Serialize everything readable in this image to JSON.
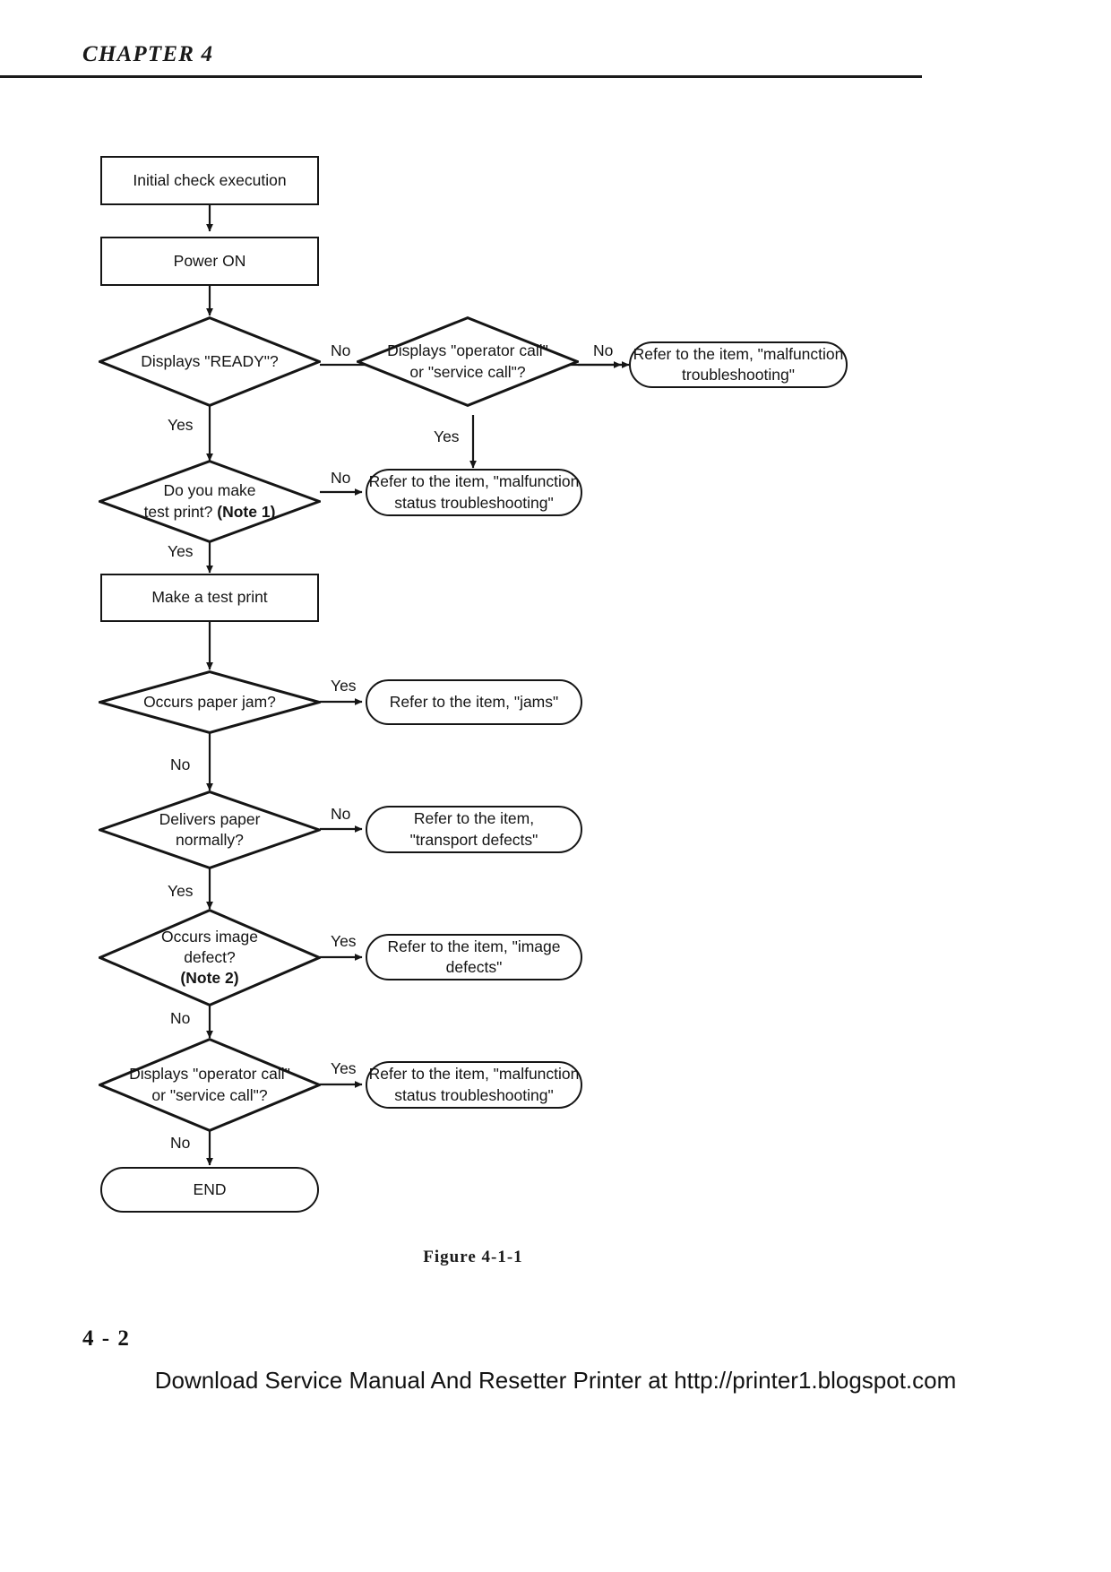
{
  "page": {
    "chapter": "CHAPTER 4",
    "figure_caption": "Figure 4-1-1",
    "page_number": "4 - 2",
    "footer": "Download Service Manual And Resetter Printer at http://printer1.blogspot.com",
    "ink_color": "#151515",
    "background_color": "#ffffff"
  },
  "flowchart": {
    "nodes": {
      "initial_check": {
        "label": "Initial check execution",
        "shape": "process"
      },
      "power_on": {
        "label": "Power ON",
        "shape": "process"
      },
      "displays_ready": {
        "label": "Displays \"READY\"?",
        "shape": "decision"
      },
      "displays_call_1_line1": {
        "label": "Displays \"operator call\"",
        "shape": "decision"
      },
      "displays_call_1_line2": {
        "label": "or \"service call\"?",
        "shape": "decision"
      },
      "malfunction_troubleshooting_line1": {
        "label": "Refer to the item, \"malfunction",
        "shape": "terminal"
      },
      "malfunction_troubleshooting_line2": {
        "label": "troubleshooting\"",
        "shape": "terminal"
      },
      "test_print_q_line1": {
        "label": "Do you make",
        "shape": "decision"
      },
      "test_print_q_line2": {
        "label": "test print? ",
        "note": "(Note 1)",
        "shape": "decision"
      },
      "malfunction_status_1_line1": {
        "label": "Refer to the item, \"malfunction",
        "shape": "terminal"
      },
      "malfunction_status_1_line2": {
        "label": "status troubleshooting\"",
        "shape": "terminal"
      },
      "make_test_print": {
        "label": "Make a test print",
        "shape": "process"
      },
      "paper_jam_q": {
        "label": "Occurs paper jam?",
        "shape": "decision"
      },
      "jams_ref": {
        "label": "Refer to the item, \"jams\"",
        "shape": "terminal"
      },
      "delivers_paper_line1": {
        "label": "Delivers paper",
        "shape": "decision"
      },
      "delivers_paper_line2": {
        "label": "normally?",
        "shape": "decision"
      },
      "transport_defects_line1": {
        "label": "Refer to the item,",
        "shape": "terminal"
      },
      "transport_defects_line2": {
        "label": "\"transport defects\"",
        "shape": "terminal"
      },
      "image_defect_line1": {
        "label": "Occurs image",
        "shape": "decision"
      },
      "image_defect_line2": {
        "label": "defect?",
        "shape": "decision"
      },
      "image_defect_note": {
        "label": "(Note 2)",
        "shape": "decision"
      },
      "image_defects_ref": {
        "label": "Refer to the item, \"image defects\"",
        "shape": "terminal"
      },
      "displays_call_2_line1": {
        "label": "Displays \"operator call\"",
        "shape": "decision"
      },
      "displays_call_2_line2": {
        "label": "or \"service call\"?",
        "shape": "decision"
      },
      "malfunction_status_2_line1": {
        "label": "Refer to the item, \"malfunction",
        "shape": "terminal"
      },
      "malfunction_status_2_line2": {
        "label": "status troubleshooting\"",
        "shape": "terminal"
      },
      "end": {
        "label": "END",
        "shape": "terminal"
      }
    },
    "edge_labels": {
      "ready_no": "No",
      "ready_yes": "Yes",
      "call1_no": "No",
      "call1_yes": "Yes",
      "testprint_no": "No",
      "testprint_yes": "Yes",
      "jam_yes": "Yes",
      "jam_no": "No",
      "delivers_no": "No",
      "delivers_yes": "Yes",
      "imgdefect_yes": "Yes",
      "imgdefect_no": "No",
      "call2_yes": "Yes",
      "call2_no": "No"
    }
  }
}
